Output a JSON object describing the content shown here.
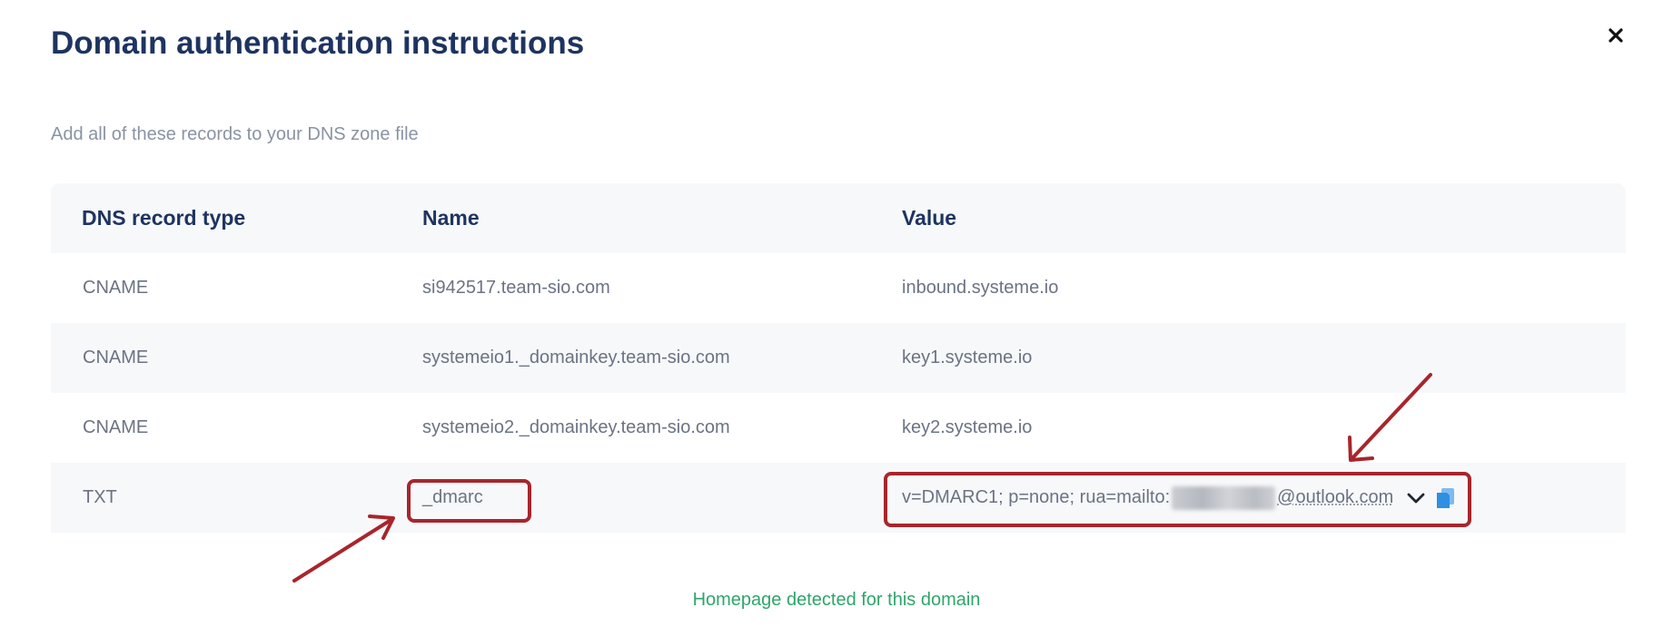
{
  "modal": {
    "title": "Domain authentication instructions",
    "close_icon": "close-icon",
    "subtitle": "Add all of these records to your DNS zone file",
    "footer_note": "Homepage detected for this domain"
  },
  "table": {
    "headers": [
      "DNS record type",
      "Name",
      "Value"
    ],
    "rows": [
      {
        "type": "CNAME",
        "name": "si942517.team-sio.com",
        "value": "inbound.systeme.io"
      },
      {
        "type": "CNAME",
        "name": "systemeio1._domainkey.team-sio.com",
        "value": "key1.systeme.io"
      },
      {
        "type": "CNAME",
        "name": "systemeio2._domainkey.team-sio.com",
        "value": "key2.systeme.io"
      },
      {
        "type": "TXT",
        "name": "_dmarc",
        "value_prefix": "v=DMARC1; p=none; rua=mailto:",
        "value_suffix": "@outlook.com",
        "value_icons": [
          "chevron-down-icon",
          "copy-icon"
        ]
      }
    ]
  },
  "colors": {
    "title": "#1e3460",
    "muted_text": "#6b7383",
    "row_stripe": "#f7f8fa",
    "annotation_red": "#a8252c",
    "success_green": "#2ea66a",
    "copy_icon_blue": "#2f8fe0"
  }
}
